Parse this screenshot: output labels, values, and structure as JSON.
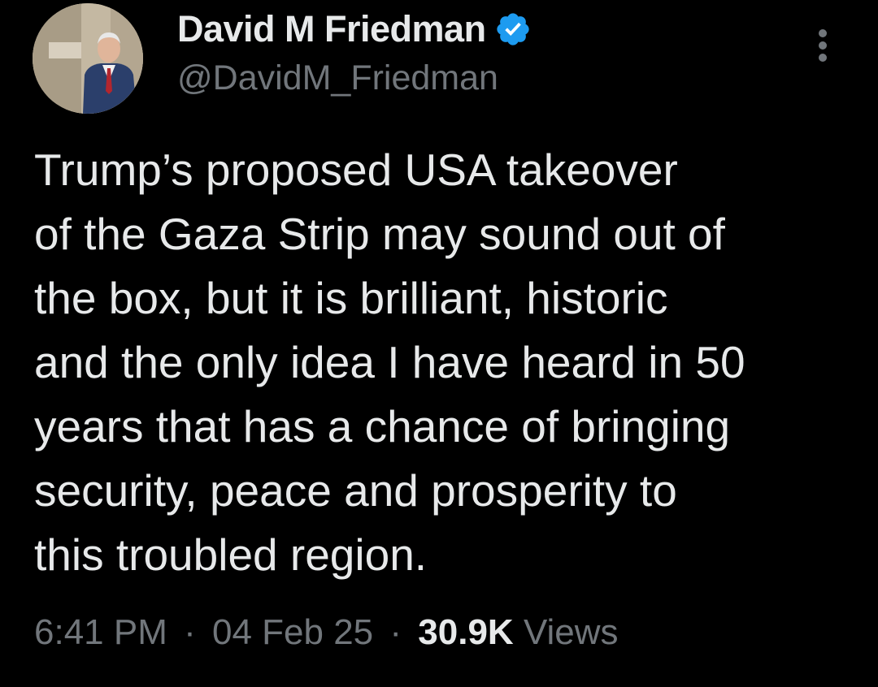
{
  "author": {
    "display_name": "David M Friedman",
    "handle": "@DavidM_Friedman",
    "verified": true,
    "avatar_icon": "profile-photo",
    "badge_color": "#1d9bf0"
  },
  "menu": {
    "icon": "more-vertical-icon"
  },
  "tweet": {
    "lines": [
      "Trump’s proposed USA takeover",
      "of the Gaza Strip may sound out of",
      "the box, but it is brilliant, historic",
      "and the only idea I have heard in 50",
      "years that has a chance of bringing",
      "security, peace and prosperity to",
      "this troubled region."
    ]
  },
  "meta": {
    "time": "6:41 PM",
    "separator": "·",
    "date": "04 Feb 25",
    "views_count": "30.9K",
    "views_label": "Views"
  },
  "colors": {
    "background": "#000000",
    "primary_text": "#e7e9ea",
    "secondary_text": "#71767b"
  }
}
